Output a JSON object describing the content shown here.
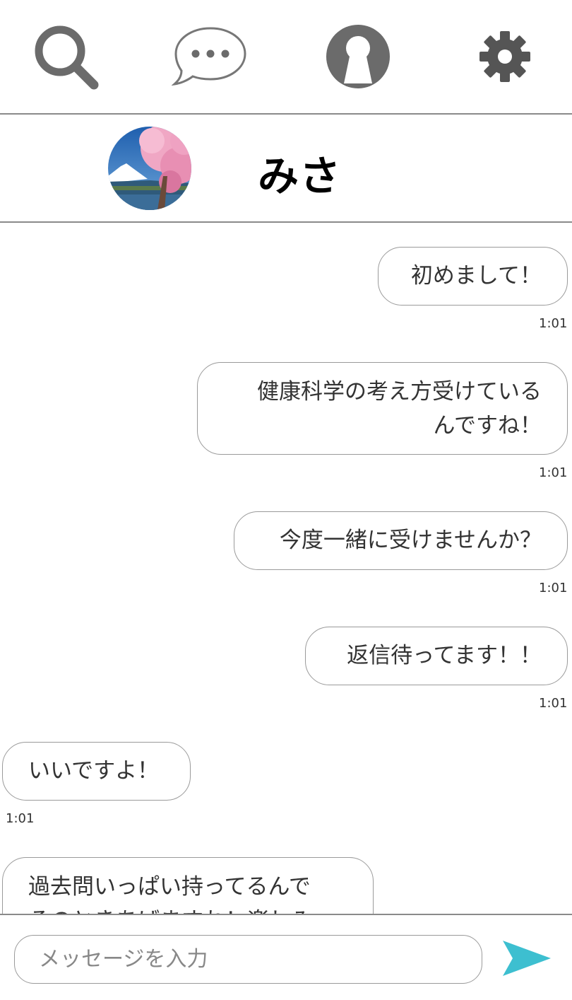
{
  "nav": {
    "items": [
      {
        "name": "search",
        "icon": "search-icon"
      },
      {
        "name": "messages",
        "icon": "chat-bubble-icon"
      },
      {
        "name": "profile",
        "icon": "user-icon"
      },
      {
        "name": "settings",
        "icon": "gear-icon"
      }
    ]
  },
  "contact": {
    "name": "みさ",
    "avatar_icon": "mount-fuji-cherry-blossom-photo"
  },
  "messages": [
    {
      "direction": "sent",
      "lines": [
        "初めまして！"
      ],
      "time": "1:01"
    },
    {
      "direction": "sent",
      "lines": [
        "健康科学の考え方受けている",
        "んですね！"
      ],
      "time": "1:01"
    },
    {
      "direction": "sent",
      "lines": [
        "今度一緒に受けませんか？"
      ],
      "time": "1:01"
    },
    {
      "direction": "sent",
      "lines": [
        "返信待ってます！！"
      ],
      "time": "1:01"
    },
    {
      "direction": "received",
      "lines": [
        "いいですよ！"
      ],
      "time": "1:01"
    },
    {
      "direction": "received",
      "lines": [
        "過去問いっぱい持ってるんで",
        "そのときあげますね！楽しみ"
      ],
      "time": ""
    }
  ],
  "composer": {
    "placeholder": "メッセージを入力",
    "value": "",
    "send_icon": "send-arrow-icon"
  },
  "colors": {
    "icon_gray": "#6b6b6b",
    "send_accent": "#3dbfd0",
    "border": "#9a9a9a"
  }
}
